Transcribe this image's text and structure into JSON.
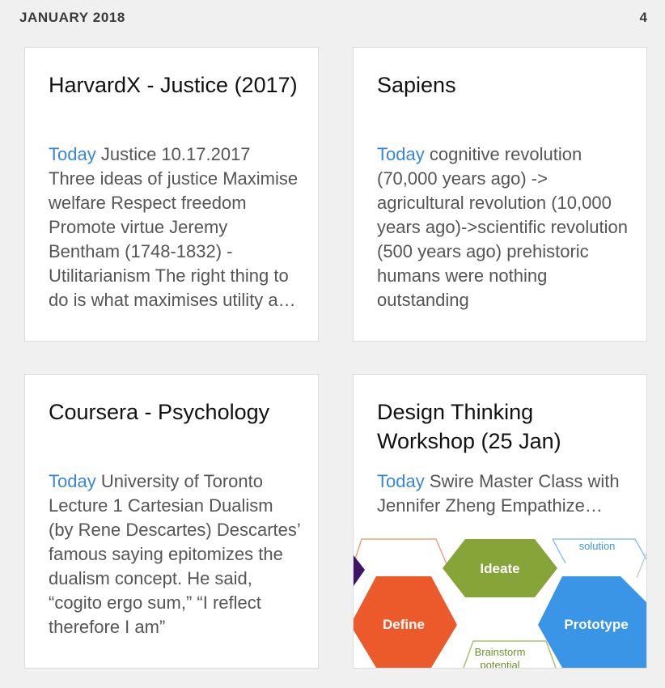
{
  "header": {
    "month": "JANUARY 2018",
    "count": "4"
  },
  "cards": [
    {
      "title": "HarvardX - Justice (2017)",
      "date_label": "Today",
      "snippet": "Justice 10.17.2017 Three ideas of justice Maximise welfare Respect freedom Promote virtue Jeremy Bentham (1748-1832) - Utilitarianism The right thing to do is what maximises utility and produces the greatest happiness"
    },
    {
      "title": "Sapiens",
      "date_label": "Today",
      "snippet": "cognitive revolution (70,000 years ago) -> agricultural revolution (10,000 years ago)->scientific revolution (500 years ago) prehistoric humans were nothing outstanding"
    },
    {
      "title": "Coursera - Psychology",
      "date_label": "Today",
      "snippet": "University of Toronto Lecture 1 Cartesian Dualism (by Rene Descartes) Descartes’ famous saying epitomizes the dualism concept. He said, “cogito ergo sum,” “I reflect therefore I am”"
    },
    {
      "title": "Design Thinking Workshop (25 Jan)",
      "date_label": "Today",
      "snippet": "Swire Master Class with Jennifer Zheng Empathize Define Ideate Prototype Test",
      "image": {
        "labels": {
          "ideate": "Ideate",
          "define": "Define",
          "prototype": "Prototype",
          "solution": "solution",
          "brainstorm": "Brainstorm",
          "potential": "potential"
        },
        "colors": {
          "ideate": "#86a437",
          "define": "#ec5a2c",
          "prototype": "#3b95e6",
          "purple": "#3d1466",
          "line_orange": "#f0a07a",
          "line_blue": "#8ec4ee",
          "line_green": "#a8c466"
        }
      }
    }
  ]
}
